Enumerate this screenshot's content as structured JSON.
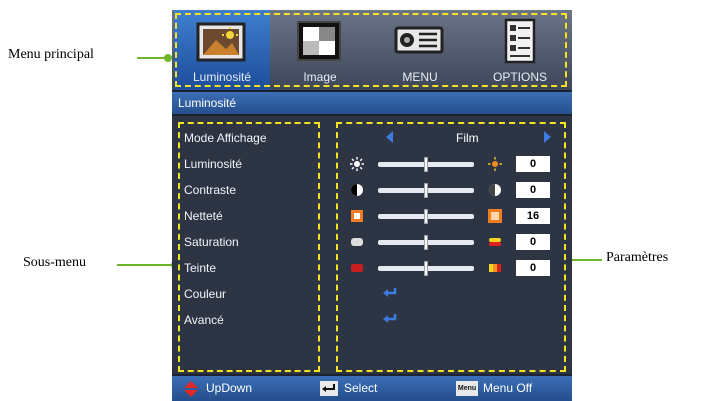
{
  "callouts": {
    "main_menu": "Menu principal",
    "submenu": "Sous-menu",
    "settings": "Paramètres"
  },
  "tabs": [
    {
      "label": "Luminosité",
      "icon": "brightness-picture-icon",
      "active": true
    },
    {
      "label": "Image",
      "icon": "image-contrast-icon",
      "active": false
    },
    {
      "label": "MENU",
      "icon": "projector-icon",
      "active": false
    },
    {
      "label": "OPTIONS",
      "icon": "options-document-icon",
      "active": false
    }
  ],
  "title": "Luminosité",
  "submenu": [
    "Mode Affichage",
    "Luminosité",
    "Contraste",
    "Netteté",
    "Saturation",
    "Teinte",
    "Couleur",
    "Avancé"
  ],
  "display_mode": "Film",
  "sliders": [
    {
      "name": "luminosite",
      "value": "0",
      "level": 0.5,
      "left_icon": "sun-dim-icon",
      "right_icon": "sun-bright-icon"
    },
    {
      "name": "contraste",
      "value": "0",
      "level": 0.5,
      "left_icon": "contrast-low-icon",
      "right_icon": "contrast-high-icon"
    },
    {
      "name": "nettete",
      "value": "16",
      "level": 0.5,
      "left_icon": "sharpness-low-icon",
      "right_icon": "sharpness-high-icon"
    },
    {
      "name": "saturation",
      "value": "0",
      "level": 0.5,
      "left_icon": "saturation-low-icon",
      "right_icon": "saturation-high-icon"
    },
    {
      "name": "teinte",
      "value": "0",
      "level": 0.5,
      "left_icon": "tint-low-icon",
      "right_icon": "tint-high-icon"
    }
  ],
  "bottom": {
    "updown": "UpDown",
    "select": "Select",
    "menu_off": "Menu Off",
    "menu_key": "Menu"
  },
  "colors": {
    "highlight": "#f6e21f",
    "callout": "#6fb52c",
    "accent_blue": "#3d7be0"
  }
}
